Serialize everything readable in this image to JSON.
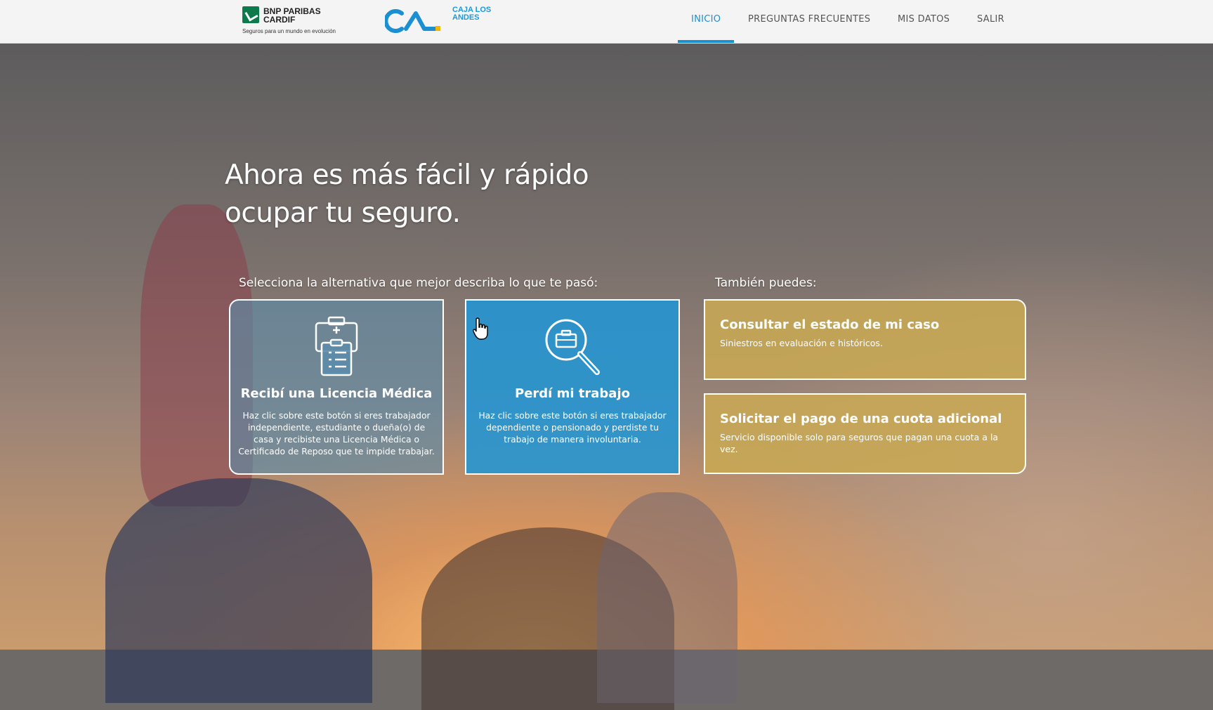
{
  "header": {
    "bnp_name": "BNP PARIBAS CARDIF",
    "bnp_tagline": "Seguros para un mundo en evolución",
    "caja_name": "CAJA LOS ANDES",
    "nav": [
      {
        "label": "INICIO",
        "active": true
      },
      {
        "label": "PREGUNTAS FRECUENTES",
        "active": false
      },
      {
        "label": "MIS DATOS",
        "active": false
      },
      {
        "label": "SALIR",
        "active": false
      }
    ],
    "accent_color": "#1a8fd1",
    "bnp_color": "#0c7a4a"
  },
  "hero": {
    "title": "Ahora es más fácil y rápido ocupar tu seguro."
  },
  "alternatives": {
    "label": "Selecciona la alternativa que mejor describa lo que te pasó:",
    "cards": [
      {
        "icon": "medical-clipboard-icon",
        "title": "Recibí una Licencia Médica",
        "description": "Haz clic sobre este botón si eres trabajador independiente, estudiante o dueña(o) de casa y recibiste una Licencia Médica o Certificado de Reposo que te impide trabajar."
      },
      {
        "icon": "job-search-icon",
        "title": "Perdí mi trabajo",
        "description": "Haz clic sobre este botón si eres trabajador dependiente o pensionado y perdiste tu trabajo de manera involuntaria."
      }
    ]
  },
  "also": {
    "label": "También puedes:",
    "options": [
      {
        "title": "Consultar el estado de mi caso",
        "description": "Siniestros en evaluación e históricos."
      },
      {
        "title": "Solicitar el pago de una cuota adicional",
        "description": "Servicio disponible solo para seguros que pagan una cuota a la vez."
      }
    ],
    "option_color": "#c8a854"
  }
}
